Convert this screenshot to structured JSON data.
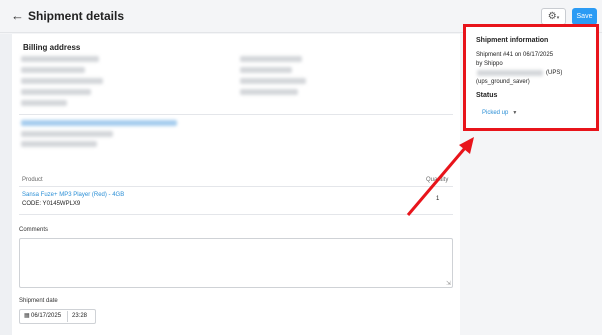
{
  "header": {
    "title": "Shipment details",
    "back_icon": "arrow-left-icon",
    "settings_icon": "gear-icon",
    "save_label": "Save"
  },
  "billing": {
    "title": "Billing address"
  },
  "products": {
    "columns": [
      "Product",
      "Quantity"
    ],
    "rows": [
      {
        "name": "Sansa Fuze+ MP3 Player (Red) - 4GB",
        "code": "CODE: Y0145WPLX9",
        "quantity": "1"
      }
    ]
  },
  "comments": {
    "label": "Comments",
    "value": ""
  },
  "shipment_date": {
    "label": "Shipment date",
    "date": "06/17/2025",
    "time": "23:28"
  },
  "shipment_info": {
    "title": "Shipment information",
    "line1": "Shipment #41 on 06/17/2025",
    "line2": "by Shippo",
    "carrier": "(UPS)",
    "service": "(ups_ground_saver)",
    "status_title": "Status",
    "status_value": "Picked up"
  },
  "colors": {
    "accent": "#2b9bf4",
    "highlight": "#e8141b",
    "link": "#2b8fd6"
  }
}
